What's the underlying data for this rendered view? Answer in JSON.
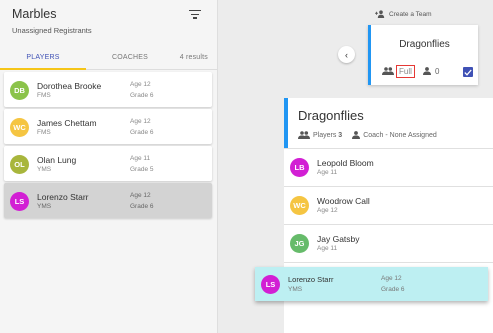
{
  "left_panel": {
    "title": "Marbles",
    "subtitle": "Unassigned Registrants",
    "tabs": [
      {
        "label": "PLAYERS",
        "active": true
      },
      {
        "label": "COACHES",
        "active": false
      }
    ],
    "results": "4 results",
    "players": [
      {
        "initials": "DB",
        "name": "Dorothea Brooke",
        "school": "FMS",
        "age": "Age 12",
        "grade": "Grade 6",
        "color": "#8bc34a",
        "selected": false
      },
      {
        "initials": "WC",
        "name": "James Chettam",
        "school": "FMS",
        "age": "Age 12",
        "grade": "Grade 6",
        "color": "#f5c542",
        "selected": false
      },
      {
        "initials": "OL",
        "name": "Olan Lung",
        "school": "YMS",
        "age": "Age 11",
        "grade": "Grade 5",
        "color": "#a8b63c",
        "selected": false
      },
      {
        "initials": "LS",
        "name": "Lorenzo Starr",
        "school": "YMS",
        "age": "Age 12",
        "grade": "Grade 6",
        "color": "#d21fd4",
        "selected": true
      }
    ]
  },
  "create_team": {
    "label": "Create a Team",
    "icon": "add-group-icon"
  },
  "back_button": {
    "icon": "chevron-left-icon",
    "glyph": "‹"
  },
  "team_card": {
    "name": "Dragonflies",
    "status": "Full",
    "coach_count": "0",
    "checked": true,
    "accent": "#2196f3"
  },
  "roster": {
    "title": "Dragonflies",
    "players_label": "Players",
    "players_count": "3",
    "coach_label": "Coach - None Assigned",
    "members": [
      {
        "initials": "LB",
        "name": "Leopold Bloom",
        "age": "Age 11",
        "color": "#d21fd4"
      },
      {
        "initials": "WC",
        "name": "Woodrow Call",
        "age": "Age 12",
        "color": "#f5c542"
      },
      {
        "initials": "JG",
        "name": "Jay Gatsby",
        "age": "Age 11",
        "color": "#66bb6a"
      }
    ]
  },
  "dragging": {
    "initials": "LS",
    "name": "Lorenzo Starr",
    "school": "YMS",
    "age": "Age 12",
    "grade": "Grade 6",
    "color": "#d21fd4"
  }
}
